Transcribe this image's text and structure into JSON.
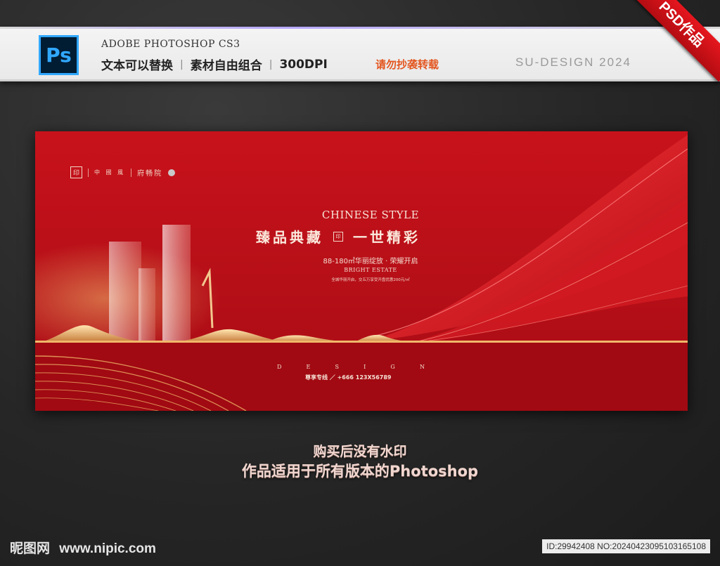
{
  "header": {
    "app_name": "ADOBE PHOTOSHOP CS3",
    "ps_label": "Ps",
    "features": [
      "文本可以替换",
      "素材自由组合",
      "300DPI"
    ],
    "separator": "|",
    "warning": "请勿抄袭转载",
    "brand": "SU-DESIGN 2024",
    "ribbon": "PSD作品"
  },
  "banner": {
    "brand_small": "中 國 風",
    "brand_name": "府畅院",
    "headline_en": "CHINESE STYLE",
    "headline_cn_left": "臻品典藏",
    "headline_cn_right": "一世精彩",
    "area_line": "88-180㎡华丽绽放 · 荣耀开启",
    "estate_en": "BRIGHT ESTATE",
    "small_note": "全城华丽开启，交五万享受开盘优惠200元/㎡",
    "design_letters": [
      "D",
      "E",
      "S",
      "I",
      "G",
      "N"
    ],
    "hotline": "尊享专线 ／ +666 123X56789"
  },
  "footer": {
    "line1": "购买后没有水印",
    "line2": "作品适用于所有版本的Photoshop",
    "site_cn": "昵图网",
    "site_url": "www.nipic.com",
    "image_id": "ID:29942408 NO:20240423095103165108"
  },
  "colors": {
    "banner_red": "#c8121b",
    "accent_gold": "#e7b77a",
    "warning_orange": "#e3561f",
    "ps_blue": "#31a8ff"
  }
}
